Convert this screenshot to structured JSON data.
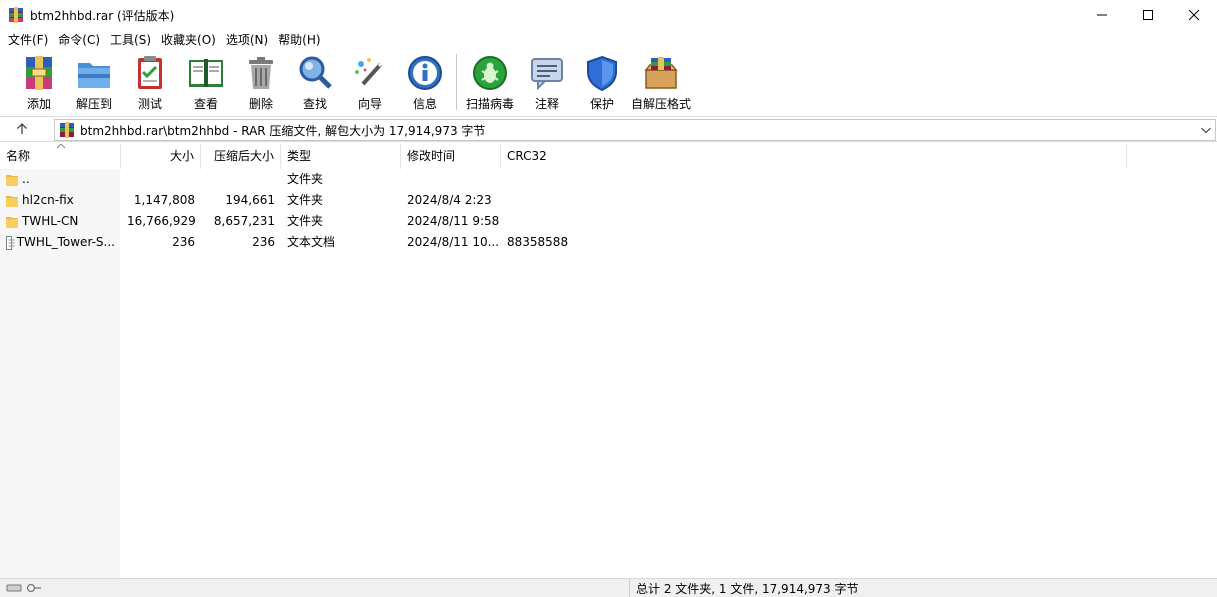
{
  "window": {
    "title": "btm2hhbd.rar (评估版本)",
    "controls": [
      "minimize",
      "maximize",
      "close"
    ]
  },
  "menu": [
    "文件(F)",
    "命令(C)",
    "工具(S)",
    "收藏夹(O)",
    "选项(N)",
    "帮助(H)"
  ],
  "toolbar": {
    "buttons": [
      {
        "label": "添加",
        "icon": "add-archive-icon"
      },
      {
        "label": "解压到",
        "icon": "extract-folder-icon"
      },
      {
        "label": "测试",
        "icon": "test-clipboard-icon"
      },
      {
        "label": "查看",
        "icon": "view-book-icon"
      },
      {
        "label": "删除",
        "icon": "trash-icon"
      },
      {
        "label": "查找",
        "icon": "magnifier-icon"
      },
      {
        "label": "向导",
        "icon": "wizard-wand-icon"
      },
      {
        "label": "信息",
        "icon": "info-icon"
      },
      {
        "label": "扫描病毒",
        "icon": "virus-scan-icon"
      },
      {
        "label": "注释",
        "icon": "comment-icon"
      },
      {
        "label": "保护",
        "icon": "shield-icon"
      },
      {
        "label": "自解压格式",
        "icon": "sfx-box-icon"
      }
    ]
  },
  "address": {
    "path_text": "btm2hhbd.rar\\btm2hhbd - RAR 压缩文件, 解包大小为 17,914,973 字节"
  },
  "columns": [
    "名称",
    "大小",
    "压缩后大小",
    "类型",
    "修改时间",
    "CRC32"
  ],
  "rows": [
    {
      "name": "..",
      "size": "",
      "packed": "",
      "type": "文件夹",
      "modified": "",
      "crc": "",
      "kind": "folder"
    },
    {
      "name": "hl2cn-fix",
      "size": "1,147,808",
      "packed": "194,661",
      "type": "文件夹",
      "modified": "2024/8/4 2:23",
      "crc": "",
      "kind": "folder"
    },
    {
      "name": "TWHL-CN",
      "size": "16,766,929",
      "packed": "8,657,231",
      "type": "文件夹",
      "modified": "2024/8/11 9:58",
      "crc": "",
      "kind": "folder"
    },
    {
      "name": "TWHL_Tower-S...",
      "size": "236",
      "packed": "236",
      "type": "文本文档",
      "modified": "2024/8/11 10...",
      "crc": "88358588",
      "kind": "text"
    }
  ],
  "status": {
    "summary": "总计 2 文件夹, 1 文件, 17,914,973 字节"
  },
  "colors": {
    "folder": "#f7cf5c",
    "separator": "#c8c8c8",
    "status_bg": "#f0f0f0"
  }
}
